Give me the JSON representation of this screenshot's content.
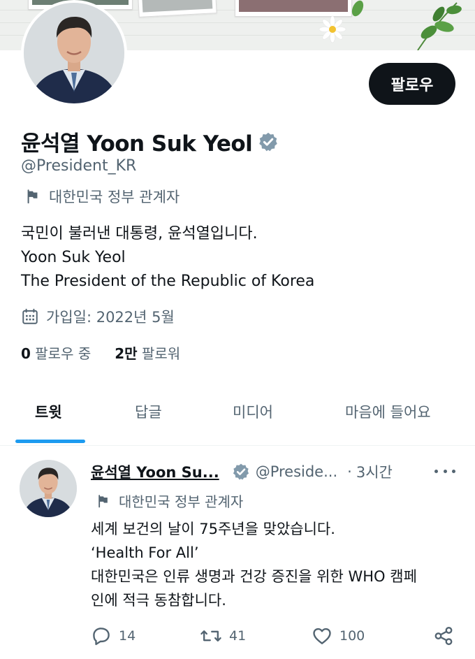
{
  "profile": {
    "display_name": "윤석열 Yoon Suk Yeol",
    "handle": "@President_KR",
    "affiliation": "대한민국 정부 관계자",
    "bio_lines": [
      "국민이 불러낸 대통령, 윤석열입니다.",
      "Yoon Suk Yeol",
      "The President of the Republic of Korea"
    ],
    "joined": "가입일: 2022년 5월",
    "follow_button": "팔로우",
    "following": {
      "count": "0",
      "label": "팔로우 중"
    },
    "followers": {
      "count": "2만",
      "label": "팔로워"
    }
  },
  "tabs": [
    {
      "label": "트윗",
      "active": true
    },
    {
      "label": "답글",
      "active": false
    },
    {
      "label": "미디어",
      "active": false
    },
    {
      "label": "마음에 들어요",
      "active": false
    }
  ],
  "tweet": {
    "author_name": "윤석열 Yoon Su...",
    "author_handle": "@Preside...",
    "separator": "·",
    "time": "3시간",
    "affiliation": "대한민국 정부 관계자",
    "text_lines": [
      "세계 보건의 날이 75주년을 맞았습니다.",
      "‘Health For All’",
      "대한민국은 인류 생명과 건강 증진을 위한 WHO 캠페",
      "인에 적극 동참합니다."
    ],
    "replies": "14",
    "retweets": "41",
    "likes": "100"
  },
  "colors": {
    "verified": "#829aab",
    "accent": "#1d9bf0",
    "secondary_text": "#536471",
    "button": "#0f1419"
  },
  "icons": [
    "verified-badge-icon",
    "flag-icon",
    "calendar-icon",
    "reply-icon",
    "retweet-icon",
    "like-icon",
    "share-icon",
    "more-icon"
  ]
}
